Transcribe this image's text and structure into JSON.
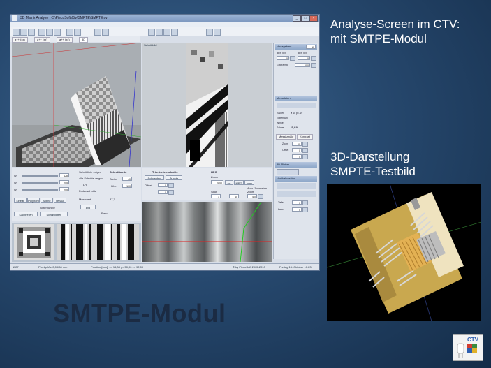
{
  "window": {
    "title": "3D Matrix Analyse | C:\\PiecoSoft\\Ctv\\SMPTE\\SMPTE.cv",
    "menu": [
      "Datei",
      "Matrix",
      "Ebenenfilter",
      "Gegenstd",
      "Auswertung",
      "Schnittbild",
      "3D Übersicht",
      "3D Projektion",
      "Volltaste",
      "Übertragung",
      "Planungsprotokoll",
      "Animation",
      "3D Tools",
      "Kontextempfehlung"
    ],
    "tabs": [
      "a++ (xx)",
      "a++ (xx)",
      "a++ (xx)",
      "3D"
    ],
    "projection_label": "Schnittbild"
  },
  "right_panel": {
    "section1": "Hexagebien",
    "field_main": "10",
    "field_a_label": "ap/P (px)",
    "field_b_label": "ap/P (px)",
    "field_a": "0",
    "field_b": "0",
    "weight_label": "Gitterabstd",
    "weight_value": "0,0",
    "section2": "Messdaten",
    "row_radius_label": "Radien",
    "row_radius_value": "ø 10 px ΔV",
    "row_dist_label": "Entfernung",
    "row_winkel_label": "Winkel",
    "row_schwe_label": "Schwe",
    "row_schwe_value": "11,4 %",
    "tab1": "Messkanäle",
    "tab2": "Kontrast",
    "zoom_label": "Zoom",
    "zoom_value": "10",
    "offset_label": "Offset",
    "offset_value": "0",
    "extra_value": "0",
    "section3": "3D-Plotter",
    "section4": "Vertikalposition",
    "tiefe_label": "Tiefe",
    "tiefe_value": "0",
    "laser_label": "Laser",
    "laser_value": "0"
  },
  "controls": {
    "slider_labels": [
      "WI",
      "WI",
      "WI"
    ],
    "slider_values": [
      "128",
      "255",
      "255"
    ],
    "check1": "Schnittlinie zeigen",
    "check2": "alle Schnitte zeigen",
    "check3": "LR",
    "check4": "Fadenschnitte",
    "width_label": "Schnittbreite",
    "width_a_label": "Breite",
    "width_a": "40",
    "width_b_label": "Höhe",
    "width_b": "100",
    "btn_linear": "Linear",
    "btn_polynom": "Polynom",
    "btn_spline": "Spline",
    "btn_verlauf": "verlauf",
    "gitter_label": "Gitterpunkte",
    "kalibrieren": "Kalibrieren",
    "schnittgitter": "Schnittgitter",
    "acht_label": "8x8",
    "messwert_label": "Messwert",
    "messwert_value": "87,7",
    "rand_label": "Rand"
  },
  "midctrl": {
    "header1": "Trim Linienschnitte",
    "header2": "HPG",
    "btn_schneiden": "Schneiden",
    "btn_punkte": "Punkte",
    "offset_label": "Offset",
    "offset_value": "0",
    "zoom_label": "Zoom",
    "zoom_value": "0,00",
    "btn_rot": "rot",
    "btn_mpg": "MPG",
    "btn_hmy": "hmy",
    "auto_label": "Auto Übernehm",
    "zoom2_label": "Zoom",
    "zoom2_value": "4,0",
    "spur_label": "Spur",
    "spur_value": "1",
    "spur2_value": "10"
  },
  "status": {
    "left": "1127",
    "pixel": "Pixelgröße 0,08/08 mm",
    "position": "Position [mm]: x= 16,08   y= 50,00   z= 92,00",
    "copyright": "© by PiecoSoft 2005-2010",
    "date": "Freitag 15. Oktober 10:23"
  },
  "slide": {
    "caption1_line1": "Analyse-Screen im CTV:",
    "caption1_line2": "mit SMTPE-Modul",
    "caption2_line1": "3D-Darstellung",
    "caption2_line2": "SMPTE-Testbild",
    "title": "SMTPE-Modul",
    "logo_text": "CTV"
  },
  "colors": {
    "background": "#27496f",
    "title": "#1b2b43",
    "caption": "#ffffff",
    "render_gold": "#d9b565"
  }
}
